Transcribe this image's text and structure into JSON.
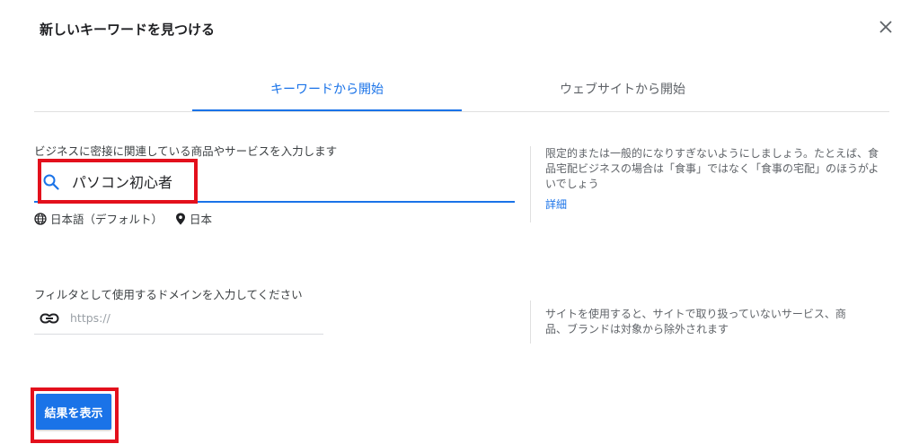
{
  "dialog": {
    "title": "新しいキーワードを見つける"
  },
  "tabs": [
    {
      "label": "キーワードから開始",
      "active": true
    },
    {
      "label": "ウェブサイトから開始",
      "active": false
    }
  ],
  "keyword_section": {
    "label": "ビジネスに密接に関連している商品やサービスを入力します",
    "value": "パソコン初心者",
    "language": "日本語（デフォルト）",
    "location": "日本",
    "hint": "限定的または一般的になりすぎないようにしましょう。たとえば、食品宅配ビジネスの場合は「食事」ではなく「食事の宅配」のほうがよいでしょう",
    "hint_link": "詳細"
  },
  "domain_section": {
    "label": "フィルタとして使用するドメインを入力してください",
    "placeholder": "https://",
    "hint": "サイトを使用すると、サイトで取り扱っていないサービス、商品、ブランドは対象から除外されます"
  },
  "actions": {
    "show_results": "結果を表示"
  },
  "colors": {
    "accent": "#1a73e8",
    "highlight": "#e3101c"
  }
}
